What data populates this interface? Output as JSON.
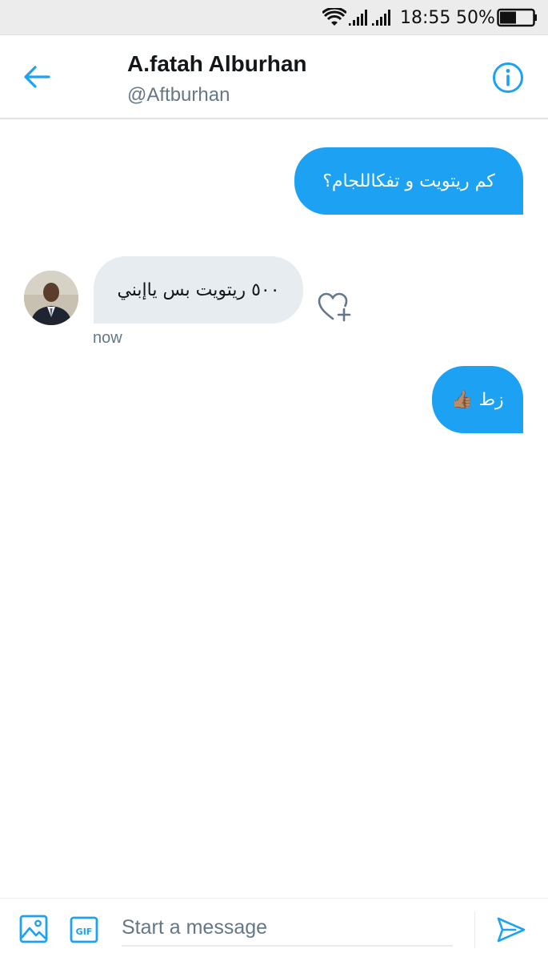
{
  "status_bar": {
    "time": "18:55",
    "battery_percent": "50%",
    "battery_level": 0.5,
    "icons": [
      "wifi-icon",
      "signal-icon",
      "signal-icon",
      "battery-icon"
    ]
  },
  "header": {
    "name": "A.fatah Alburhan",
    "handle": "@Aftburhan",
    "icons": [
      "back-arrow-icon",
      "info-icon"
    ]
  },
  "messages": [
    {
      "direction": "outgoing",
      "text": "كم ريتويت و تفكاللجام؟"
    },
    {
      "direction": "incoming",
      "text": "٥٠٠ ريتويت بس ياإبني",
      "time": "now"
    },
    {
      "direction": "outgoing",
      "text": "زط 👍🏽"
    }
  ],
  "composer": {
    "placeholder": "Start a message",
    "icons": [
      "image-icon",
      "gif-icon",
      "send-icon"
    ]
  },
  "colors": {
    "accent": "#1da1f2",
    "incoming_bubble": "#e6ecf0",
    "secondary_text": "#657786",
    "status_bar_bg": "#ececec"
  }
}
